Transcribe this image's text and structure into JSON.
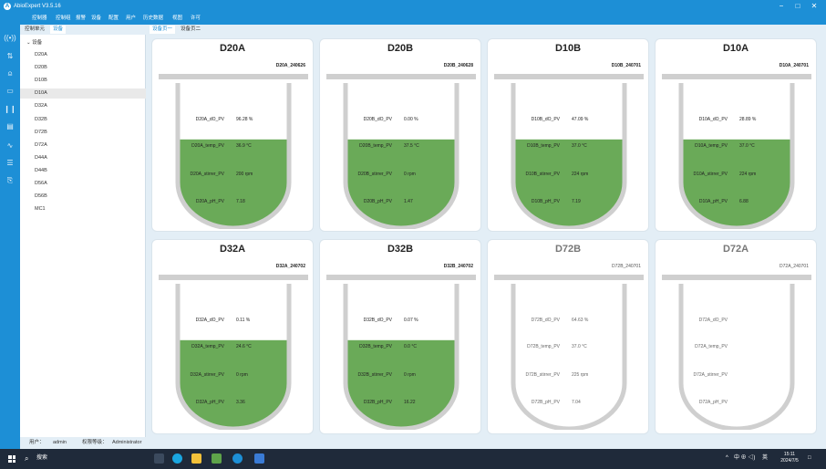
{
  "window": {
    "title": "AbioExpert V3.5.16",
    "minimize": "−",
    "maximize": "□",
    "close": "✕"
  },
  "menu": [
    "控制器",
    "控制组",
    "报警",
    "设备",
    "配置",
    "用户",
    "历史数据",
    "视图",
    "许可"
  ],
  "tree": {
    "tabs": [
      {
        "label": "控制单元",
        "active": false
      },
      {
        "label": "设备",
        "active": true
      }
    ],
    "root": "⌄ 设备",
    "items": [
      "D20A",
      "D20B",
      "D10B",
      "D10A",
      "D32A",
      "D32B",
      "D72B",
      "D72A",
      "D44A",
      "D44B",
      "D56A",
      "D56B",
      "MC1"
    ],
    "selected": "D10A"
  },
  "content_tabs": [
    {
      "label": "设备页一",
      "active": true
    },
    {
      "label": "设备页二",
      "active": false
    }
  ],
  "colors": {
    "accent": "#1d8fd6",
    "liquid": "#6aaa58",
    "vessel_wall": "#cfcfcf"
  },
  "cards": [
    {
      "name": "D20A",
      "code": "D20A_240626",
      "active": true,
      "fill": 0.6,
      "readings": [
        {
          "label": "D20A_dO_PV",
          "value": "96.28 %"
        },
        {
          "label": "D20A_temp_PV",
          "value": "36.9 °C"
        },
        {
          "label": "D20A_stirrer_PV",
          "value": "200 rpm"
        },
        {
          "label": "D20A_pH_PV",
          "value": "7.18"
        }
      ]
    },
    {
      "name": "D20B",
      "code": "D20B_240628",
      "active": true,
      "fill": 0.6,
      "readings": [
        {
          "label": "D20B_dO_PV",
          "value": "0.00 %"
        },
        {
          "label": "D20B_temp_PV",
          "value": "37.5 °C"
        },
        {
          "label": "D20B_stirrer_PV",
          "value": "0 rpm"
        },
        {
          "label": "D20B_pH_PV",
          "value": "1.47"
        }
      ]
    },
    {
      "name": "D10B",
      "code": "D10B_240701",
      "active": true,
      "fill": 0.6,
      "readings": [
        {
          "label": "D10B_dO_PV",
          "value": "47.09 %"
        },
        {
          "label": "D10B_temp_PV",
          "value": "37.0 °C"
        },
        {
          "label": "D10B_stirrer_PV",
          "value": "224 rpm"
        },
        {
          "label": "D10B_pH_PV",
          "value": "7.19"
        }
      ]
    },
    {
      "name": "D10A",
      "code": "D10A_240701",
      "active": true,
      "fill": 0.6,
      "readings": [
        {
          "label": "D10A_dO_PV",
          "value": "28.89 %"
        },
        {
          "label": "D10A_temp_PV",
          "value": "37.0 °C"
        },
        {
          "label": "D10A_stirrer_PV",
          "value": "224 rpm"
        },
        {
          "label": "D10A_pH_PV",
          "value": "6.88"
        }
      ]
    },
    {
      "name": "D32A",
      "code": "D32A_240702",
      "active": true,
      "fill": 0.6,
      "readings": [
        {
          "label": "D32A_dO_PV",
          "value": "0.11 %"
        },
        {
          "label": "D32A_temp_PV",
          "value": "24.6 °C"
        },
        {
          "label": "D32A_stirrer_PV",
          "value": "0 rpm"
        },
        {
          "label": "D32A_pH_PV",
          "value": "3.36"
        }
      ]
    },
    {
      "name": "D32B",
      "code": "D32B_240702",
      "active": true,
      "fill": 0.6,
      "readings": [
        {
          "label": "D32B_dO_PV",
          "value": "0.07 %"
        },
        {
          "label": "D32B_temp_PV",
          "value": "0.0 °C"
        },
        {
          "label": "D32B_stirrer_PV",
          "value": "0 rpm"
        },
        {
          "label": "D32B_pH_PV",
          "value": "16.22"
        }
      ]
    },
    {
      "name": "D72B",
      "code": "D72B_240701",
      "active": false,
      "fill": 0,
      "readings": [
        {
          "label": "D72B_dO_PV",
          "value": "64.63 %"
        },
        {
          "label": "D72B_temp_PV",
          "value": "37.0 °C"
        },
        {
          "label": "D72B_stirrer_PV",
          "value": "225 rpm"
        },
        {
          "label": "D72B_pH_PV",
          "value": "7.04"
        }
      ]
    },
    {
      "name": "D72A",
      "code": "D72A_240701",
      "active": false,
      "fill": 0,
      "readings": [
        {
          "label": "D72A_dO_PV",
          "value": ""
        },
        {
          "label": "D72A_temp_PV",
          "value": ""
        },
        {
          "label": "D72A_stirrer_PV",
          "value": ""
        },
        {
          "label": "D72A_pH_PV",
          "value": ""
        }
      ]
    }
  ],
  "status": {
    "user_label": "用户：",
    "user": "admin",
    "role_label": "权限等级：",
    "role": "Administrator"
  },
  "taskbar": {
    "search": "搜索",
    "apps": [
      "file-explorer",
      "edge-browser",
      "file-manager",
      "system-app",
      "abioexpert-app",
      "document-app"
    ],
    "tray_arrow": "^",
    "tray_icons": "中 ⊕ ◁)",
    "ime": "英",
    "time": "15:11",
    "date": "2024/7/5",
    "notification": "□"
  }
}
